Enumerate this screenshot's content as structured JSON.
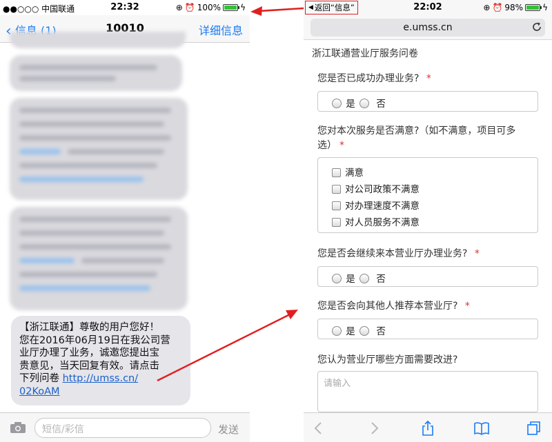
{
  "left": {
    "status": {
      "carrier": "●●○○○ 中国联通",
      "time": "22:32",
      "battery": "100%",
      "battery_level": 1.0
    },
    "nav": {
      "back": "信息 (1)",
      "title": "10010",
      "detail": "详细信息"
    },
    "message": {
      "line1": "【浙江联通】尊敬的用户您好！",
      "line2": "您在2016年06月19日在我公司营",
      "line3": "业厅办理了业务，诚邀您提出宝",
      "line4": "贵意见，当天回复有效。请点击",
      "line5_prefix": "下列问卷 ",
      "link_part1": "http://umss.cn/",
      "link_part2": "02KoAM"
    },
    "input": {
      "placeholder": "短信/彩信",
      "send": "发送"
    }
  },
  "right": {
    "status": {
      "back_info": "返回“信息”",
      "time": "22:02",
      "battery": "98%",
      "battery_level": 0.98
    },
    "url": "e.umss.cn",
    "survey": {
      "title": "浙江联通营业厅服务问卷",
      "q1": {
        "text": "您是否已成功办理业务?",
        "yes": "是",
        "no": "否"
      },
      "q2": {
        "text_line1": "您对本次服务是否满意?（如不满意，项目可多",
        "text_line2": "选）",
        "options": [
          "满意",
          "对公司政策不满意",
          "对办理速度不满意",
          "对人员服务不满意"
        ]
      },
      "q3": {
        "text": "您是否会继续来本营业厅办理业务?",
        "yes": "是",
        "no": "否"
      },
      "q4": {
        "text": "您是否会向其他人推荐本营业厅?",
        "yes": "是",
        "no": "否"
      },
      "q5": {
        "text": "您认为营业厅哪些方面需要改进?",
        "placeholder": "请输入"
      },
      "required_mark": "*"
    }
  },
  "colors": {
    "ios_blue": "#1a7cf5",
    "arrow_red": "#e02020",
    "bubble_gray": "#e5e5ea"
  }
}
